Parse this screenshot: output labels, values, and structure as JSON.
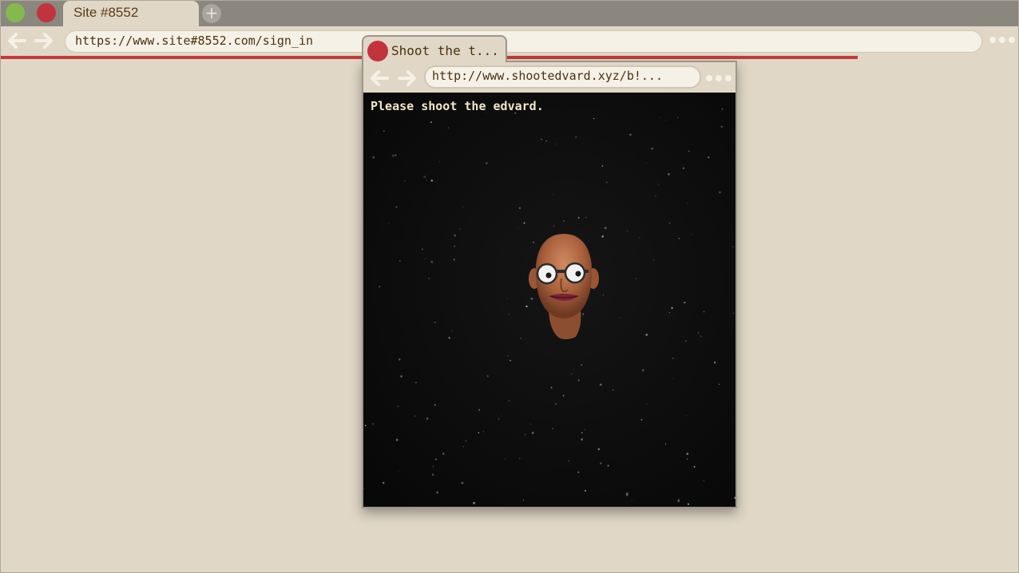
{
  "main_window": {
    "tab_title": "Site #8552",
    "new_tab_symbol": "+",
    "address": "https://www.site#8552.com/sign_in",
    "icons": [
      "back-icon",
      "forward-icon",
      "more-menu-icon",
      "new-tab-icon"
    ],
    "colors": {
      "close": "#c1343d",
      "maximize": "#86b94d",
      "progress": "#c23b3b"
    }
  },
  "popup": {
    "tab_title": "Shoot the t...",
    "address": "http://www.shootedvard.xyz/b!...",
    "icons": [
      "back-icon",
      "forward-icon",
      "more-menu-icon"
    ],
    "game": {
      "instructions": "Please shoot the edvard.",
      "target": "edvard-head"
    }
  }
}
